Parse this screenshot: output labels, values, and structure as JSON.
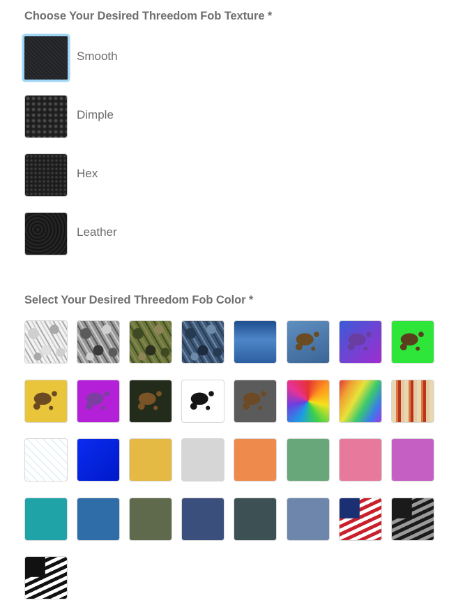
{
  "texture_section": {
    "title": "Choose Your Desired Threedom Fob Texture *",
    "options": [
      {
        "label": "Smooth",
        "selected": true
      },
      {
        "label": "Dimple",
        "selected": false
      },
      {
        "label": "Hex",
        "selected": false
      },
      {
        "label": "Leather",
        "selected": false
      }
    ]
  },
  "color_section": {
    "title": "Select Your Desired Threedom Fob Color *",
    "swatches": [
      {
        "pattern": "white-camo"
      },
      {
        "pattern": "gray-camo"
      },
      {
        "pattern": "woodland-camo"
      },
      {
        "pattern": "blue-camo"
      },
      {
        "pattern": "blue-metallic"
      },
      {
        "pattern": "blue-mud-splatter"
      },
      {
        "pattern": "purple-blue-mud-splatter"
      },
      {
        "pattern": "green-mud-splatter"
      },
      {
        "pattern": "yellow-mud-splatter"
      },
      {
        "pattern": "magenta-mud-splatter"
      },
      {
        "pattern": "dark-green-mud-splatter"
      },
      {
        "pattern": "black-white-splatter"
      },
      {
        "pattern": "gray-mud-splatter"
      },
      {
        "pattern": "tie-dye-spiral"
      },
      {
        "pattern": "rainbow-feather"
      },
      {
        "pattern": "wood-grain"
      },
      {
        "pattern": "white-digital"
      },
      {
        "pattern": "blue-lightning"
      },
      {
        "pattern": "yellow"
      },
      {
        "pattern": "light-gray"
      },
      {
        "pattern": "orange"
      },
      {
        "pattern": "green"
      },
      {
        "pattern": "pink"
      },
      {
        "pattern": "purple"
      },
      {
        "pattern": "teal"
      },
      {
        "pattern": "blue"
      },
      {
        "pattern": "olive"
      },
      {
        "pattern": "navy"
      },
      {
        "pattern": "slate"
      },
      {
        "pattern": "denim"
      },
      {
        "pattern": "american-flag"
      },
      {
        "pattern": "black-gray-flag"
      },
      {
        "pattern": "black-white-flag"
      }
    ]
  }
}
